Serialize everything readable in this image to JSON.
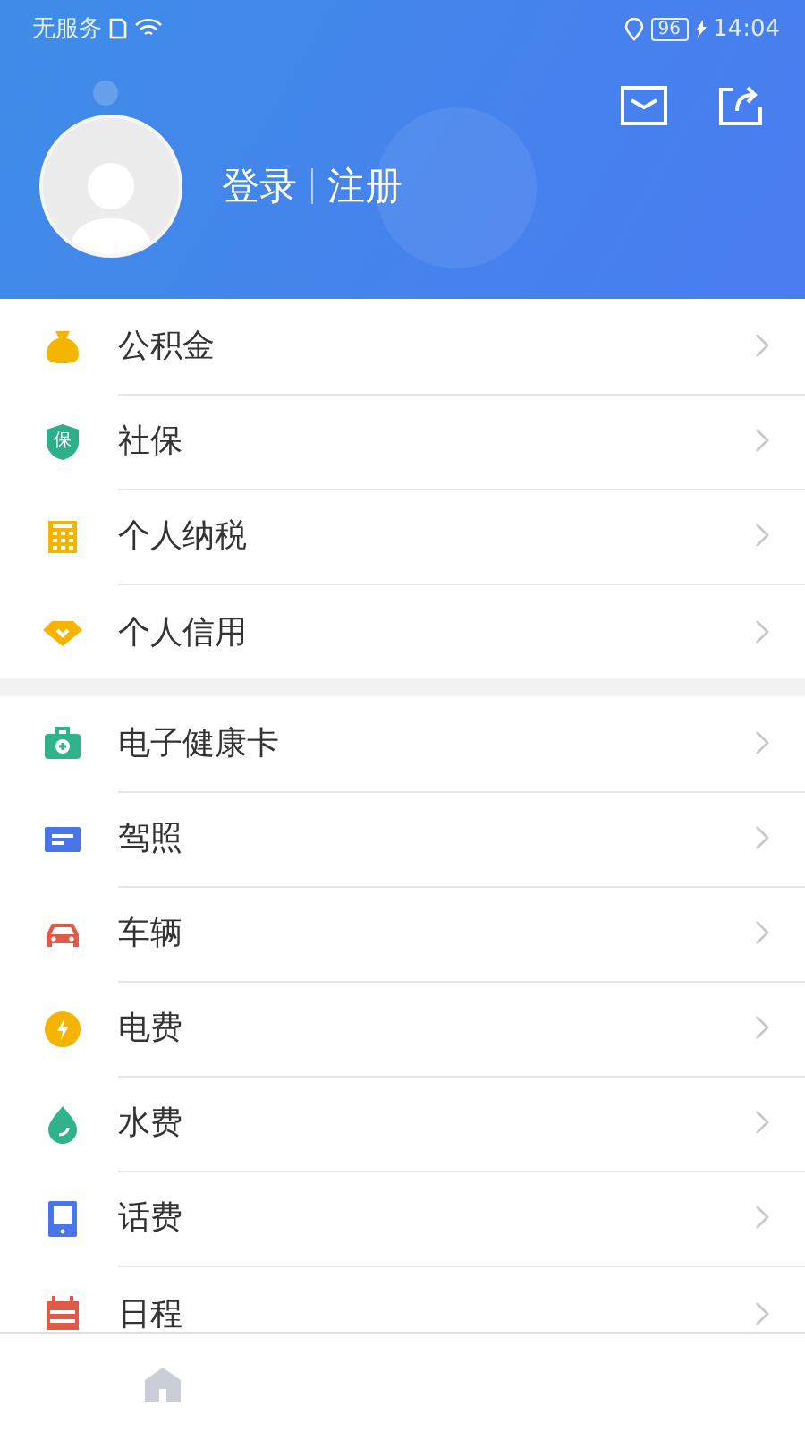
{
  "status_bar": {
    "carrier": "无服务",
    "battery": "96",
    "time": "14:04"
  },
  "header": {
    "login": "登录",
    "register": "注册"
  },
  "groups": [
    {
      "items": [
        {
          "label": "公积金",
          "kind": "moneybag"
        },
        {
          "label": "社保",
          "kind": "shield",
          "glyph": "保"
        },
        {
          "label": "个人纳税",
          "kind": "calculator"
        },
        {
          "label": "个人信用",
          "kind": "diamond"
        }
      ]
    },
    {
      "items": [
        {
          "label": "电子健康卡",
          "kind": "medkit"
        },
        {
          "label": "驾照",
          "kind": "card"
        },
        {
          "label": "车辆",
          "kind": "car"
        },
        {
          "label": "电费",
          "kind": "bolt"
        },
        {
          "label": "水费",
          "kind": "drop"
        },
        {
          "label": "话费",
          "kind": "bill"
        },
        {
          "label": "日程",
          "kind": "calendar"
        }
      ]
    }
  ]
}
